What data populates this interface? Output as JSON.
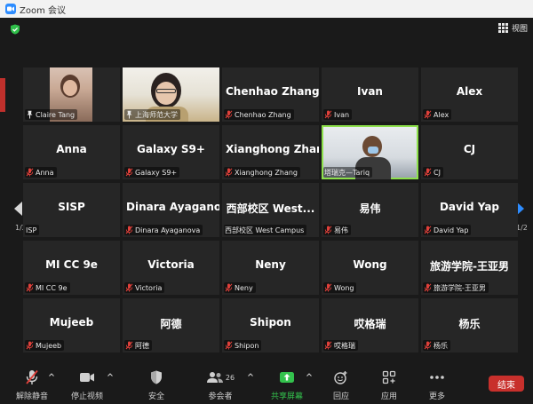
{
  "window": {
    "title": "Zoom 会议"
  },
  "top": {
    "view_label": "视图"
  },
  "pager": {
    "left": "1/2",
    "right": "1/2"
  },
  "tiles": [
    {
      "name": "",
      "label": "Claire Tang",
      "icon": "pin"
    },
    {
      "name": "",
      "label": "上海师范大学",
      "icon": "pin"
    },
    {
      "name": "Chenhao Zhang",
      "label": "Chenhao Zhang",
      "icon": "mic"
    },
    {
      "name": "Ivan",
      "label": "Ivan",
      "icon": "mic"
    },
    {
      "name": "Alex",
      "label": "Alex",
      "icon": "mic"
    },
    {
      "name": "Anna",
      "label": "Anna",
      "icon": "mic"
    },
    {
      "name": "Galaxy S9+",
      "label": "Galaxy S9+",
      "icon": "mic"
    },
    {
      "name": "Xianghong Zhang",
      "label": "Xianghong Zhang",
      "icon": "mic"
    },
    {
      "name": "",
      "label": "塔瑞克—Tariq",
      "icon": "none"
    },
    {
      "name": "CJ",
      "label": "CJ",
      "icon": "mic"
    },
    {
      "name": "SISP",
      "label": "ISP",
      "icon": "none"
    },
    {
      "name": "Dinara  Ayagano...",
      "label": "Dinara Ayaganova",
      "icon": "mic"
    },
    {
      "name": "西部校区 West...",
      "label": "西部校区 West Campus",
      "icon": "none"
    },
    {
      "name": "易伟",
      "label": "易伟",
      "icon": "mic"
    },
    {
      "name": "David Yap",
      "label": "David Yap",
      "icon": "mic"
    },
    {
      "name": "MI CC 9e",
      "label": "MI CC 9e",
      "icon": "mic"
    },
    {
      "name": "Victoria",
      "label": "Victoria",
      "icon": "mic"
    },
    {
      "name": "Neny",
      "label": "Neny",
      "icon": "mic"
    },
    {
      "name": "Wong",
      "label": "Wong",
      "icon": "mic"
    },
    {
      "name": "旅游学院-王亚男",
      "label": "旅游学院-王亚男",
      "icon": "mic"
    },
    {
      "name": "Mujeeb",
      "label": "Mujeeb",
      "icon": "mic"
    },
    {
      "name": "阿德",
      "label": "阿德",
      "icon": "mic"
    },
    {
      "name": "Shipon",
      "label": "Shipon",
      "icon": "mic"
    },
    {
      "name": "哎格瑞",
      "label": "哎格瑞",
      "icon": "mic"
    },
    {
      "name": "杨乐",
      "label": "杨乐",
      "icon": "mic"
    }
  ],
  "toolbar": {
    "unmute": "解除静音",
    "stop_video": "停止视频",
    "security": "安全",
    "participants": "参会者",
    "participants_count": "26",
    "share": "共享屏幕",
    "reactions": "回应",
    "apps": "应用",
    "more": "更多",
    "end": "结束"
  },
  "colors": {
    "accent_green": "#33c24d",
    "end_red": "#c8302c",
    "active_border": "#8de04b",
    "muted_red": "#e0403a"
  }
}
